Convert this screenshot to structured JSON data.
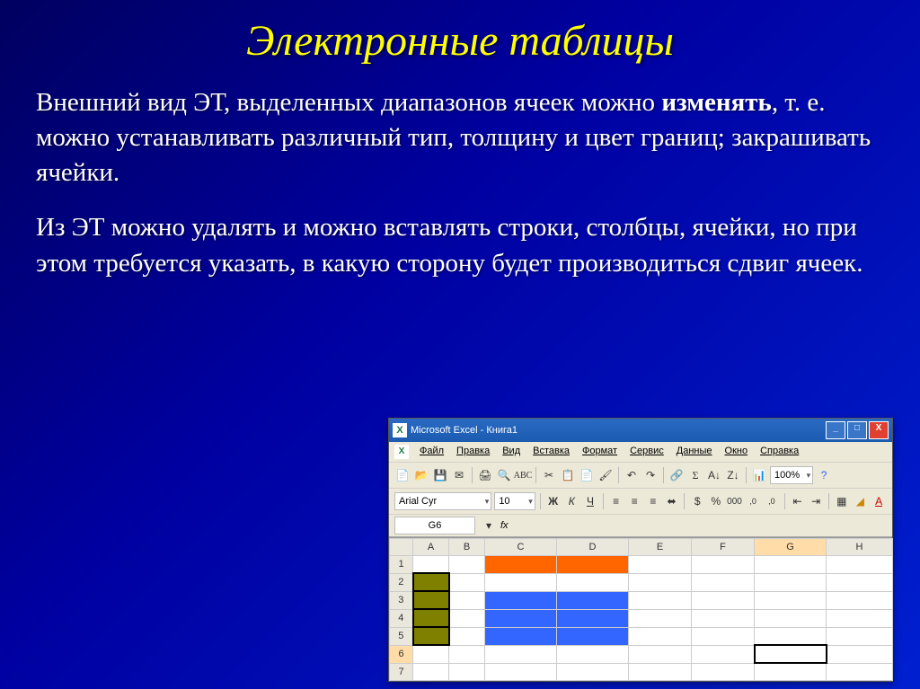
{
  "slide": {
    "title": "Электронные таблицы",
    "para1_prefix": "Внешний вид ЭТ, выделенных диапазонов ячеек можно ",
    "para1_bold": "изменять",
    "para1_suffix": ", т. е. можно устанавливать различный тип, толщину и цвет границ; закрашивать ячейки.",
    "para2": "Из ЭТ можно удалять и можно вставлять строки, столбцы, ячейки, но при этом требуется указать, в какую сторону будет производиться сдвиг ячеек."
  },
  "excel": {
    "titlebar": "Microsoft Excel - Книга1",
    "win_min": "_",
    "win_max": "□",
    "win_close": "X",
    "menu": {
      "file": "Файл",
      "edit": "Правка",
      "view": "Вид",
      "insert": "Вставка",
      "format": "Формат",
      "tools": "Сервис",
      "data": "Данные",
      "window": "Окно",
      "help": "Справка"
    },
    "toolbar": {
      "zoom": "100%",
      "font": "Arial Cyr",
      "size": "10"
    },
    "namebox": "G6",
    "fx_label": "fx",
    "cols": [
      "A",
      "B",
      "C",
      "D",
      "E",
      "F",
      "G",
      "H"
    ],
    "rows": [
      "1",
      "2",
      "3",
      "4",
      "5",
      "6",
      "7"
    ]
  }
}
